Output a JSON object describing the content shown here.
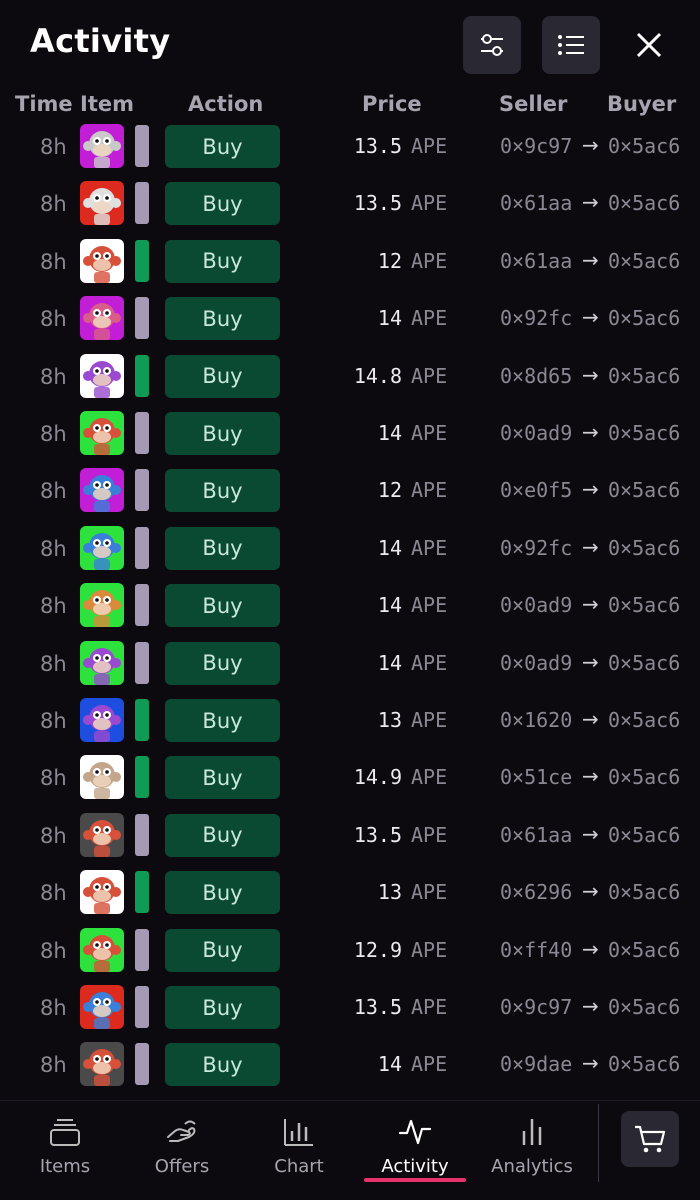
{
  "header": {
    "title": "Activity",
    "icons": [
      "sliders-icon",
      "list-icon",
      "close-icon"
    ]
  },
  "columns": {
    "time": "Time",
    "item": "Item",
    "action": "Action",
    "price": "Price",
    "seller": "Seller",
    "buyer": "Buyer"
  },
  "colors": {
    "buy_button": "#0a4a33",
    "rarity_purple": "#a59ab4",
    "rarity_green": "#0f9a55",
    "active_tab_underline": "#e8326b"
  },
  "rows": [
    {
      "time": "8h",
      "action": "Buy",
      "price": "13.5",
      "currency": "APE",
      "seller": "0×9c97",
      "buyer": "0×5ac6",
      "bg": "#c21ed6",
      "face": "#c9c9c9",
      "rarity": "purple"
    },
    {
      "time": "8h",
      "action": "Buy",
      "price": "13.5",
      "currency": "APE",
      "seller": "0×61aa",
      "buyer": "0×5ac6",
      "bg": "#dc2a1e",
      "face": "#e0e0e0",
      "rarity": "purple"
    },
    {
      "time": "8h",
      "action": "Buy",
      "price": "12",
      "currency": "APE",
      "seller": "0×61aa",
      "buyer": "0×5ac6",
      "bg": "#ffffff",
      "face": "#d7503a",
      "rarity": "green"
    },
    {
      "time": "8h",
      "action": "Buy",
      "price": "14",
      "currency": "APE",
      "seller": "0×92fc",
      "buyer": "0×5ac6",
      "bg": "#c21ed6",
      "face": "#d95c8a",
      "rarity": "purple"
    },
    {
      "time": "8h",
      "action": "Buy",
      "price": "14.8",
      "currency": "APE",
      "seller": "0×8d65",
      "buyer": "0×5ac6",
      "bg": "#ffffff",
      "face": "#9a4ad0",
      "rarity": "green"
    },
    {
      "time": "8h",
      "action": "Buy",
      "price": "14",
      "currency": "APE",
      "seller": "0×0ad9",
      "buyer": "0×5ac6",
      "bg": "#2ee23e",
      "face": "#d7503a",
      "rarity": "purple"
    },
    {
      "time": "8h",
      "action": "Buy",
      "price": "12",
      "currency": "APE",
      "seller": "0×e0f5",
      "buyer": "0×5ac6",
      "bg": "#c21ed6",
      "face": "#3a7fd8",
      "rarity": "purple"
    },
    {
      "time": "8h",
      "action": "Buy",
      "price": "14",
      "currency": "APE",
      "seller": "0×92fc",
      "buyer": "0×5ac6",
      "bg": "#2ee23e",
      "face": "#3a7fd8",
      "rarity": "purple"
    },
    {
      "time": "8h",
      "action": "Buy",
      "price": "14",
      "currency": "APE",
      "seller": "0×0ad9",
      "buyer": "0×5ac6",
      "bg": "#2ee23e",
      "face": "#d98a3a",
      "rarity": "purple"
    },
    {
      "time": "8h",
      "action": "Buy",
      "price": "14",
      "currency": "APE",
      "seller": "0×0ad9",
      "buyer": "0×5ac6",
      "bg": "#2ee23e",
      "face": "#9a4ad0",
      "rarity": "purple"
    },
    {
      "time": "8h",
      "action": "Buy",
      "price": "13",
      "currency": "APE",
      "seller": "0×1620",
      "buyer": "0×5ac6",
      "bg": "#1e4ee0",
      "face": "#9a4ad0",
      "rarity": "green"
    },
    {
      "time": "8h",
      "action": "Buy",
      "price": "14.9",
      "currency": "APE",
      "seller": "0×51ce",
      "buyer": "0×5ac6",
      "bg": "#ffffff",
      "face": "#c2a58a",
      "rarity": "green"
    },
    {
      "time": "8h",
      "action": "Buy",
      "price": "13.5",
      "currency": "APE",
      "seller": "0×61aa",
      "buyer": "0×5ac6",
      "bg": "#4a4a4a",
      "face": "#d7503a",
      "rarity": "purple"
    },
    {
      "time": "8h",
      "action": "Buy",
      "price": "13",
      "currency": "APE",
      "seller": "0×6296",
      "buyer": "0×5ac6",
      "bg": "#ffffff",
      "face": "#d7503a",
      "rarity": "green"
    },
    {
      "time": "8h",
      "action": "Buy",
      "price": "12.9",
      "currency": "APE",
      "seller": "0×ff40",
      "buyer": "0×5ac6",
      "bg": "#2ee23e",
      "face": "#d7503a",
      "rarity": "purple"
    },
    {
      "time": "8h",
      "action": "Buy",
      "price": "13.5",
      "currency": "APE",
      "seller": "0×9c97",
      "buyer": "0×5ac6",
      "bg": "#dc2a1e",
      "face": "#3a7fd8",
      "rarity": "purple"
    },
    {
      "time": "8h",
      "action": "Buy",
      "price": "14",
      "currency": "APE",
      "seller": "0×9dae",
      "buyer": "0×5ac6",
      "bg": "#4a4a4a",
      "face": "#d7503a",
      "rarity": "purple"
    }
  ],
  "tabs": [
    {
      "label": "Items",
      "icon": "items-stack-icon"
    },
    {
      "label": "Offers",
      "icon": "offers-hand-icon"
    },
    {
      "label": "Chart",
      "icon": "bar-chart-icon"
    },
    {
      "label": "Activity",
      "icon": "activity-pulse-icon",
      "active": true
    },
    {
      "label": "Analytics",
      "icon": "analytics-bars-icon"
    }
  ],
  "cart": {
    "icon": "cart-icon"
  }
}
